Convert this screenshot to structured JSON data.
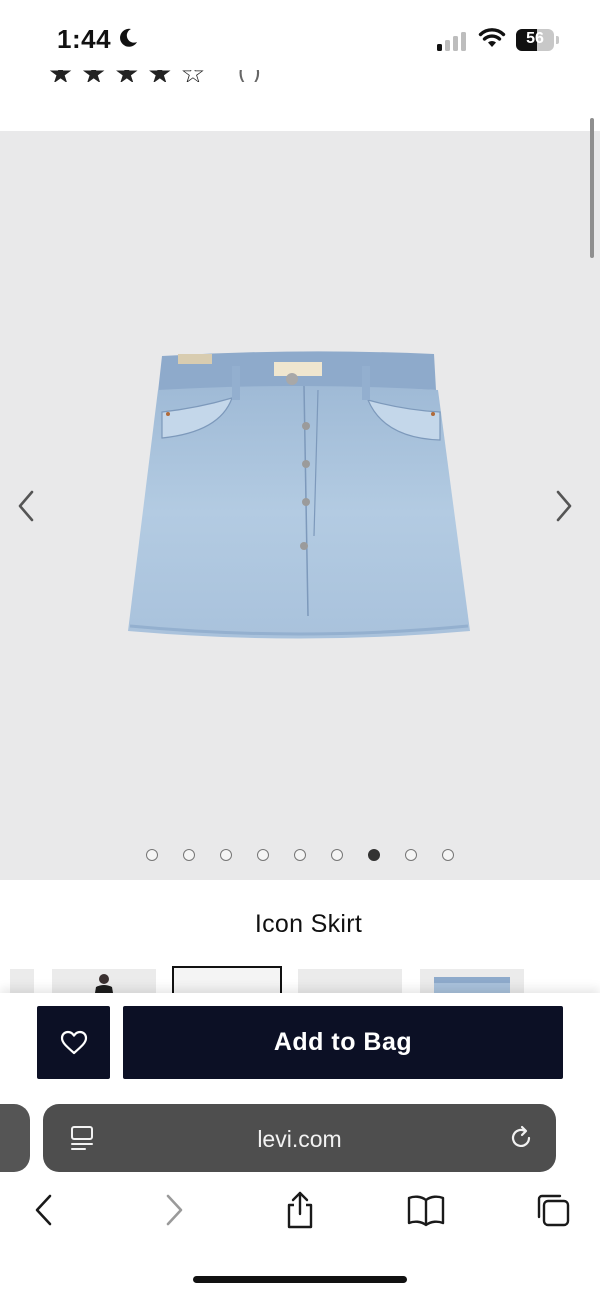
{
  "status_bar": {
    "time": "1:44",
    "battery_level": "56",
    "battery_fraction": 0.56
  },
  "rating": {
    "stars_filled": 4,
    "stars_total": 5
  },
  "gallery": {
    "image_count": 9,
    "active_index": 6,
    "product_image_icon": "denim-mini-skirt"
  },
  "product": {
    "title": "Icon Skirt"
  },
  "actions": {
    "wishlist_icon": "heart-icon",
    "add_to_bag_label": "Add to Bag"
  },
  "browser": {
    "url": "levi.com"
  },
  "colors": {
    "button_bg": "#0c1025",
    "gallery_bg": "#e9e9ea"
  }
}
